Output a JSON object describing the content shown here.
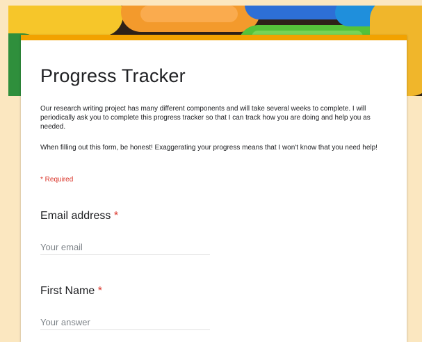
{
  "form": {
    "title": "Progress Tracker",
    "description_1": "Our research writing project has many different components and will take several weeks to complete. I will periodically ask you to complete this progress tracker so that I can track how you are doing and help you as needed.",
    "description_2": "When filling out this form, be honest! Exaggerating your progress means that I won't know that you need help!",
    "required_note": "* Required",
    "required_marker": "*",
    "accent_color": "#f2a200",
    "required_color": "#d93025",
    "background_color": "#fbe7c0"
  },
  "questions": [
    {
      "label": "Email address",
      "placeholder": "Your email",
      "value": ""
    },
    {
      "label": "First Name",
      "placeholder": "Your answer",
      "value": ""
    }
  ],
  "banner": {
    "image": "colorful-candy-photo"
  }
}
